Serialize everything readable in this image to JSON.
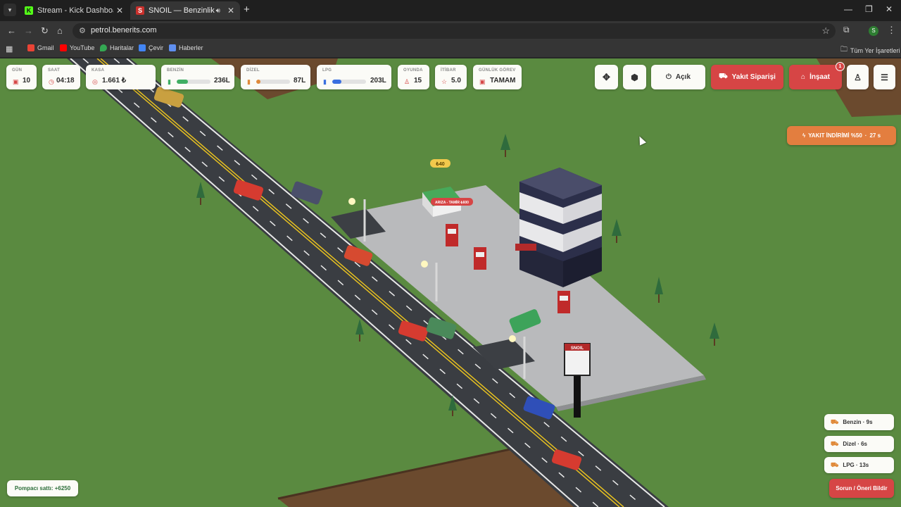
{
  "browser": {
    "tabs": [
      {
        "title": "Stream - Kick Dashboard",
        "favicon": "kick-icon",
        "active": false
      },
      {
        "title": "SNOIL — Benzinlik",
        "favicon": "snoil-icon",
        "active": true
      }
    ],
    "url": "petrol.benerits.com",
    "profile_initial": "S",
    "bookmarks": [
      {
        "label": "Gmail",
        "color": "#ea4335"
      },
      {
        "label": "YouTube",
        "color": "#ff0000"
      },
      {
        "label": "Haritalar",
        "color": "#34a853"
      },
      {
        "label": "Çevir",
        "color": "#4285f4"
      },
      {
        "label": "Haberler",
        "color": "#5f8ff0"
      }
    ],
    "all_bookmarks": "Tüm Yer İşaretleri"
  },
  "hud": {
    "gun": {
      "label": "GÜN",
      "value": "10"
    },
    "saat": {
      "label": "SAAT",
      "value": "04:18"
    },
    "kasa": {
      "label": "KASA",
      "value": "1.661 ₺"
    },
    "benzin": {
      "label": "BENZİN",
      "value": "236L",
      "fill": 0.34,
      "color": "#3fae63"
    },
    "dizel": {
      "label": "DİZEL",
      "value": "87L",
      "fill": 0.12,
      "color": "#e08a3a"
    },
    "lpg": {
      "label": "LPG",
      "value": "203L",
      "fill": 0.27,
      "color": "#3a6fe0"
    },
    "oyunda": {
      "label": "OYUNDA",
      "value": "15"
    },
    "itibar": {
      "label": "İTİBAR",
      "value": "5.0"
    },
    "gorev": {
      "label": "GÜNLÜK GÖREV",
      "value": "TAMAM"
    }
  },
  "actions": {
    "status": "Açık",
    "fuel_order": "Yakıt Siparişi",
    "build": "İnşaat",
    "build_badge": "1"
  },
  "promo": {
    "text": "YAKIT İNDİRİMİ %50",
    "timer": "27 s"
  },
  "queue": [
    {
      "label": "Benzin · 9s"
    },
    {
      "label": "Dizel · 6s"
    },
    {
      "label": "LPG · 13s"
    }
  ],
  "report_button": "Sorun / Öneri Bildir",
  "toast": "Pompacı sattı: +6250",
  "scene": {
    "coin_tag": "₺40",
    "breakdown_tag": "ARIZA - TAMİR ₺600",
    "sign_brand": "SNOIL"
  }
}
